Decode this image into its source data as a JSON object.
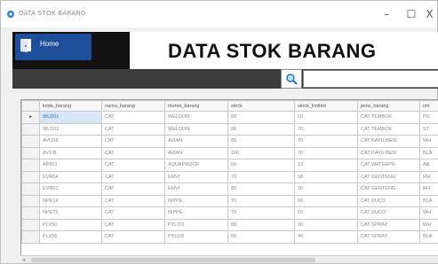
{
  "window": {
    "title": "DATA STOK BARANG",
    "icon": "app-icon",
    "controls": {
      "minimize": "–",
      "maximize": "☐",
      "close": "X"
    }
  },
  "header": {
    "home_label": "Home",
    "home_icon": "home-icon",
    "title": "DATA STOK BARANG"
  },
  "toolbar": {
    "search_icon": "search-icon",
    "search_value": ""
  },
  "table": {
    "columns": [
      "kode_barang",
      "nama_barang",
      "merek_barang",
      "stock",
      "stock_limited",
      "jenis_barang",
      "nm"
    ],
    "current_row_marker": "▸",
    "rows": [
      [
        "WLD01",
        "CAT",
        "WELDON",
        "80",
        "60",
        "CAT TEMBOK",
        "PU"
      ],
      [
        "WLD02",
        "CAT",
        "WELDON",
        "80",
        "70",
        "CAT TEMBOK",
        "ST"
      ],
      [
        "AVI108",
        "CAT",
        "AVIAN",
        "80",
        "70",
        "CAT KAYU BESI",
        "WH"
      ],
      [
        "AVY-B",
        "CAT",
        "AVIAN",
        "100",
        "70",
        "CAT KAYU BESI",
        "BLA"
      ],
      [
        "AP801",
        "CAT",
        "AQUAPROOF",
        "50",
        "13",
        "CAT WATERPR",
        "AB"
      ],
      [
        "EVR04",
        "CAT",
        "EMVI",
        "70",
        "58",
        "CAT GENTENG",
        "RH"
      ],
      [
        "EVR01",
        "CAT",
        "EMVI",
        "80",
        "30",
        "CAT GENTENG",
        "RH"
      ],
      [
        "NPE14",
        "CAT",
        "NIPPE",
        "70",
        "60",
        "CAT DUCO",
        "BLA"
      ],
      [
        "NPE75",
        "CAT",
        "NIPPE",
        "70",
        "60",
        "CAT DUCO",
        "WH"
      ],
      [
        "PLX50",
        "CAT",
        "PYLOX",
        "80",
        "30",
        "CAT SPRAY",
        "WH"
      ],
      [
        "PLX56",
        "CAT",
        "PYLOX",
        "50",
        "40",
        "CAT SPRAY",
        "BLA"
      ]
    ]
  },
  "colors": {
    "header_dark": "#111111",
    "home_button": "#1f4e9a",
    "toolbar": "#3c3c3c",
    "selection": "#d7e7f7"
  }
}
